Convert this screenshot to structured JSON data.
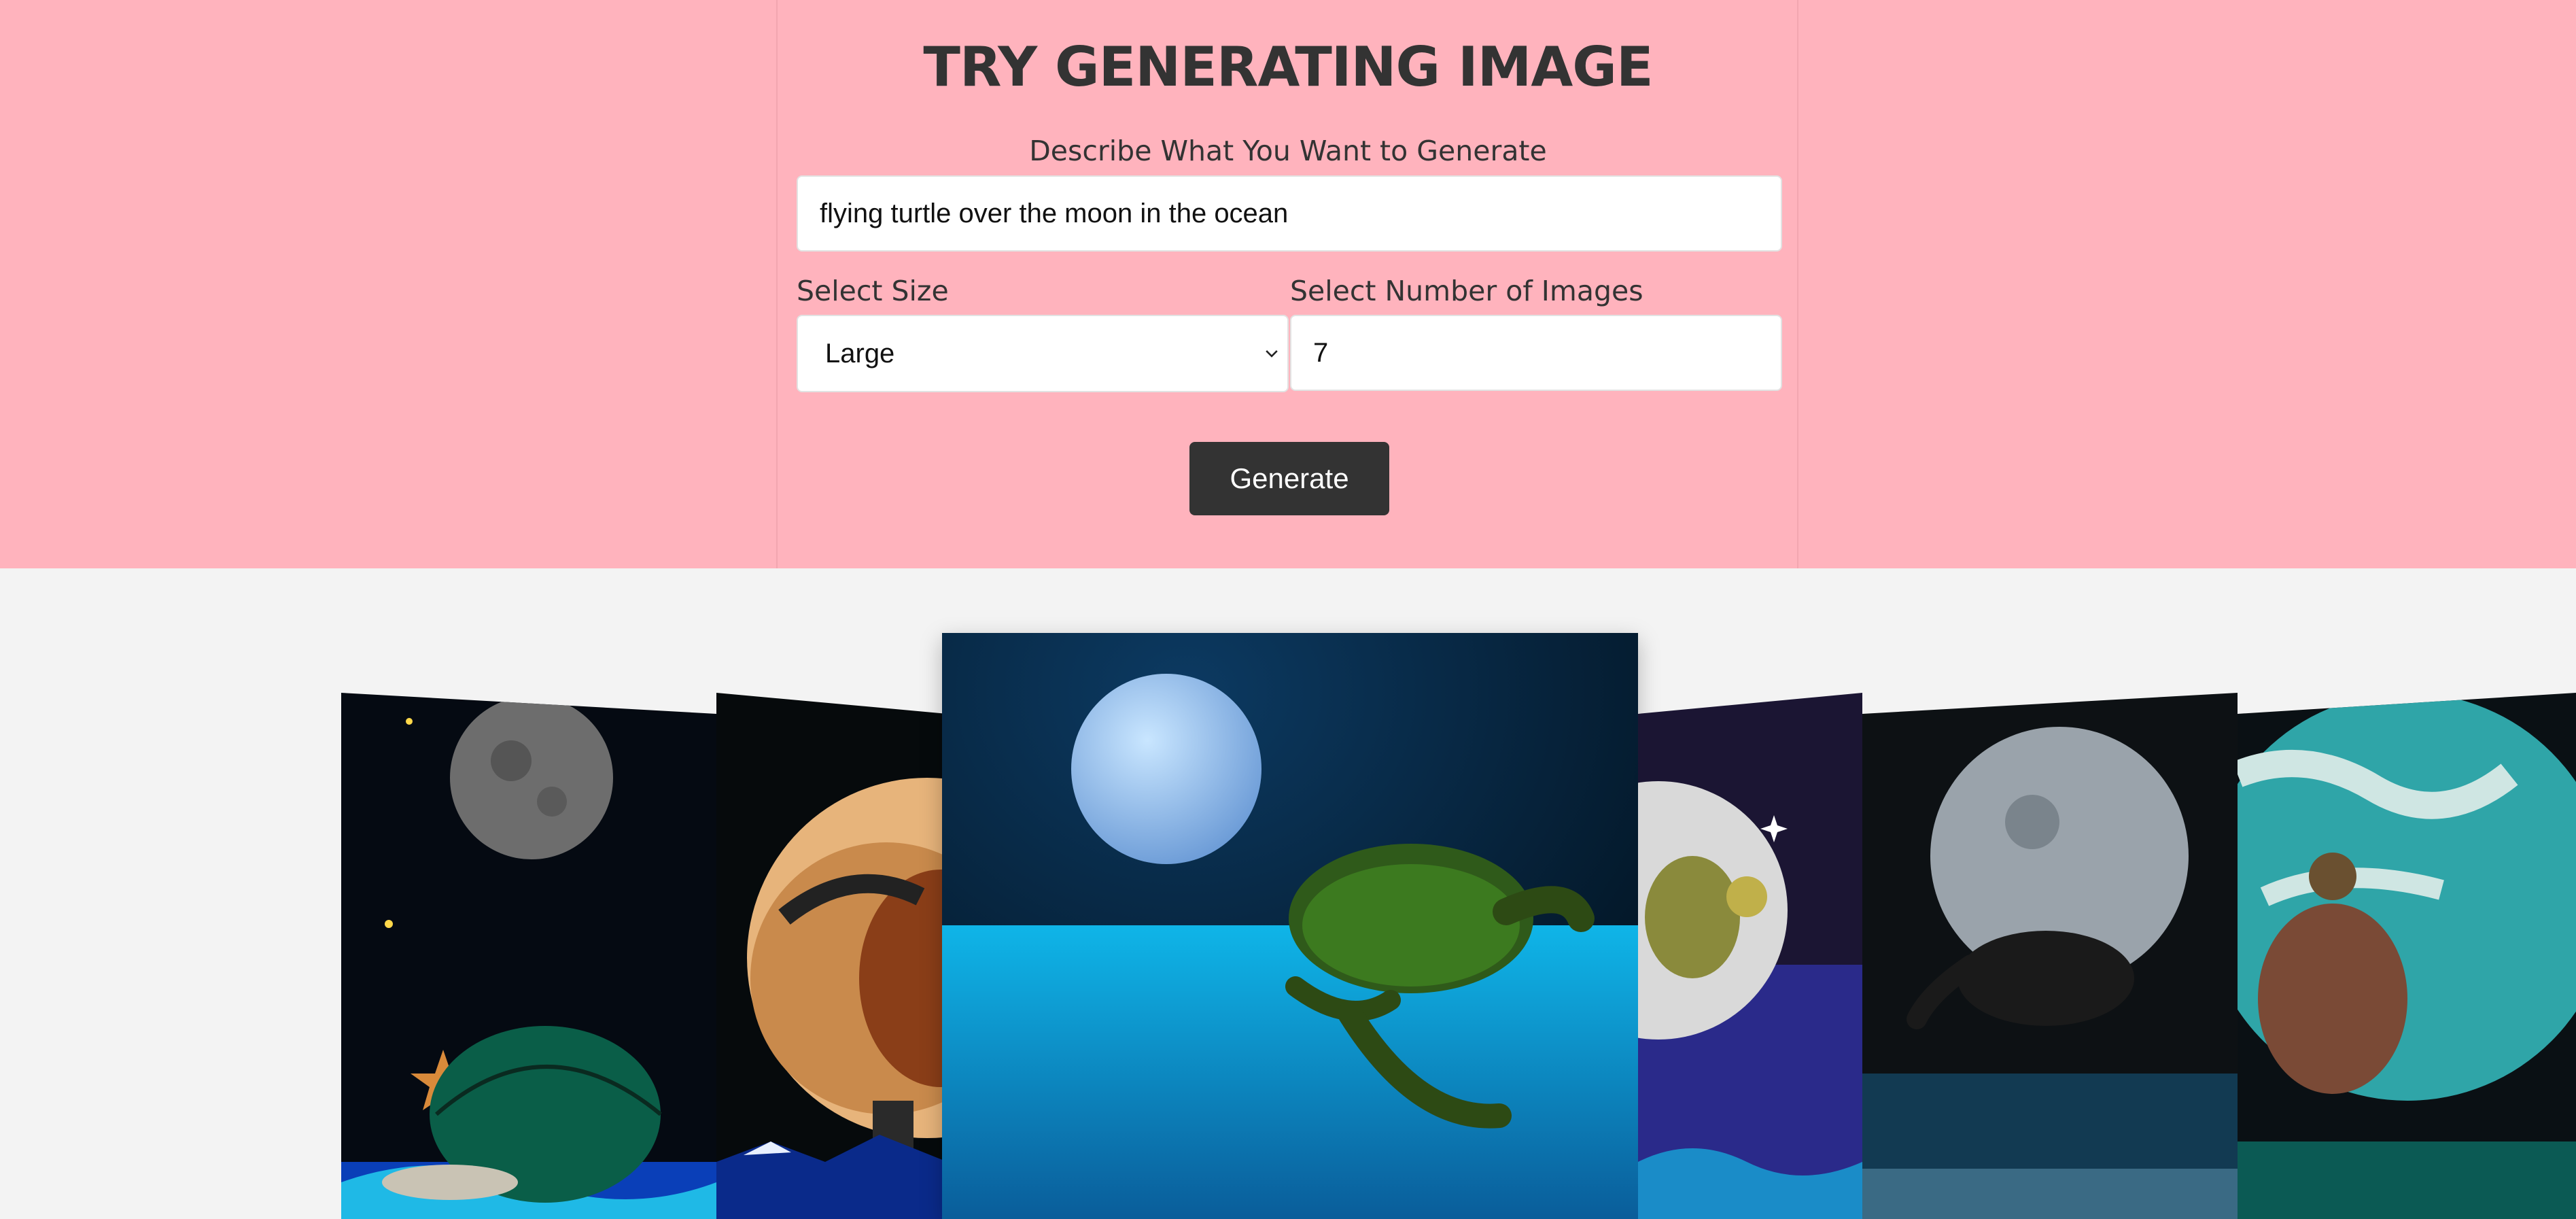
{
  "header": {
    "title": "TRY GENERATING IMAGE"
  },
  "form": {
    "prompt_label": "Describe What You Want to Generate",
    "prompt_value": "flying turtle over the moon in the ocean",
    "size_label": "Select Size",
    "size_value": "Large",
    "count_label": "Select Number of Images",
    "count_value": "7",
    "generate_label": "Generate"
  },
  "gallery": {
    "image_count": 6,
    "icons": [
      "chevron-down-icon"
    ]
  },
  "colors": {
    "hero_background": "#ffb3bd",
    "page_background": "#f3f3f3",
    "button_background": "#333333",
    "title_color": "#333333"
  }
}
